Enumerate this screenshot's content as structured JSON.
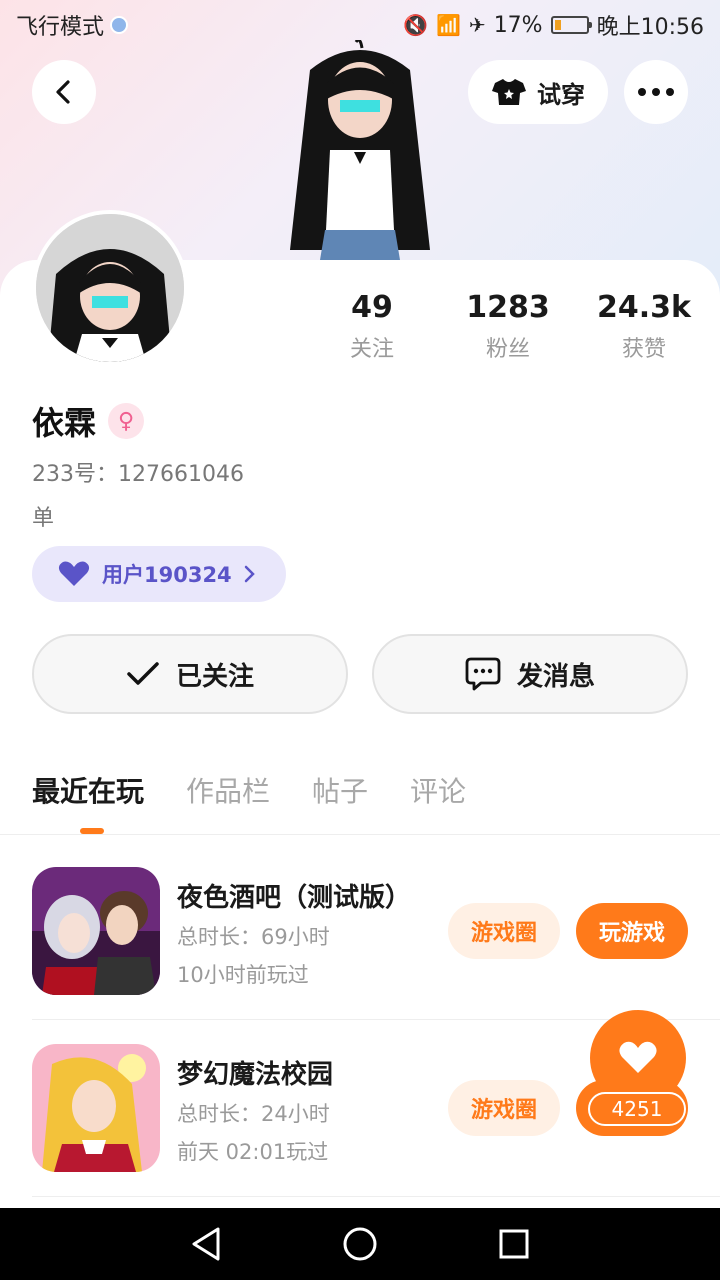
{
  "status_bar": {
    "mode": "飞行模式",
    "battery": "17%",
    "time": "晚上10:56"
  },
  "header": {
    "tryon_label": "试穿"
  },
  "profile": {
    "name": "依霖",
    "uid": "233号：127661046",
    "bio": "单",
    "fan_badge": "用户190324",
    "stats": [
      {
        "value": "49",
        "label": "关注"
      },
      {
        "value": "1283",
        "label": "粉丝"
      },
      {
        "value": "24.3k",
        "label": "获赞"
      }
    ]
  },
  "actions": {
    "follow_label": "已关注",
    "message_label": "发消息"
  },
  "tabs": [
    "最近在玩",
    "作品栏",
    "帖子",
    "评论"
  ],
  "games": [
    {
      "title": "夜色酒吧（测试版）",
      "total_time": "总时长：69小时",
      "last_played": "10小时前玩过",
      "circle_label": "游戏圈",
      "play_label": "玩游戏"
    },
    {
      "title": "梦幻魔法校园",
      "total_time": "总时长：24小时",
      "last_played": "前天 02:01玩过",
      "circle_label": "游戏圈"
    }
  ],
  "like": {
    "count": "4251"
  },
  "colors": {
    "accent": "#ff7a1a",
    "fan_pill": "#e9e7fb",
    "fan_text": "#5a54c8"
  }
}
